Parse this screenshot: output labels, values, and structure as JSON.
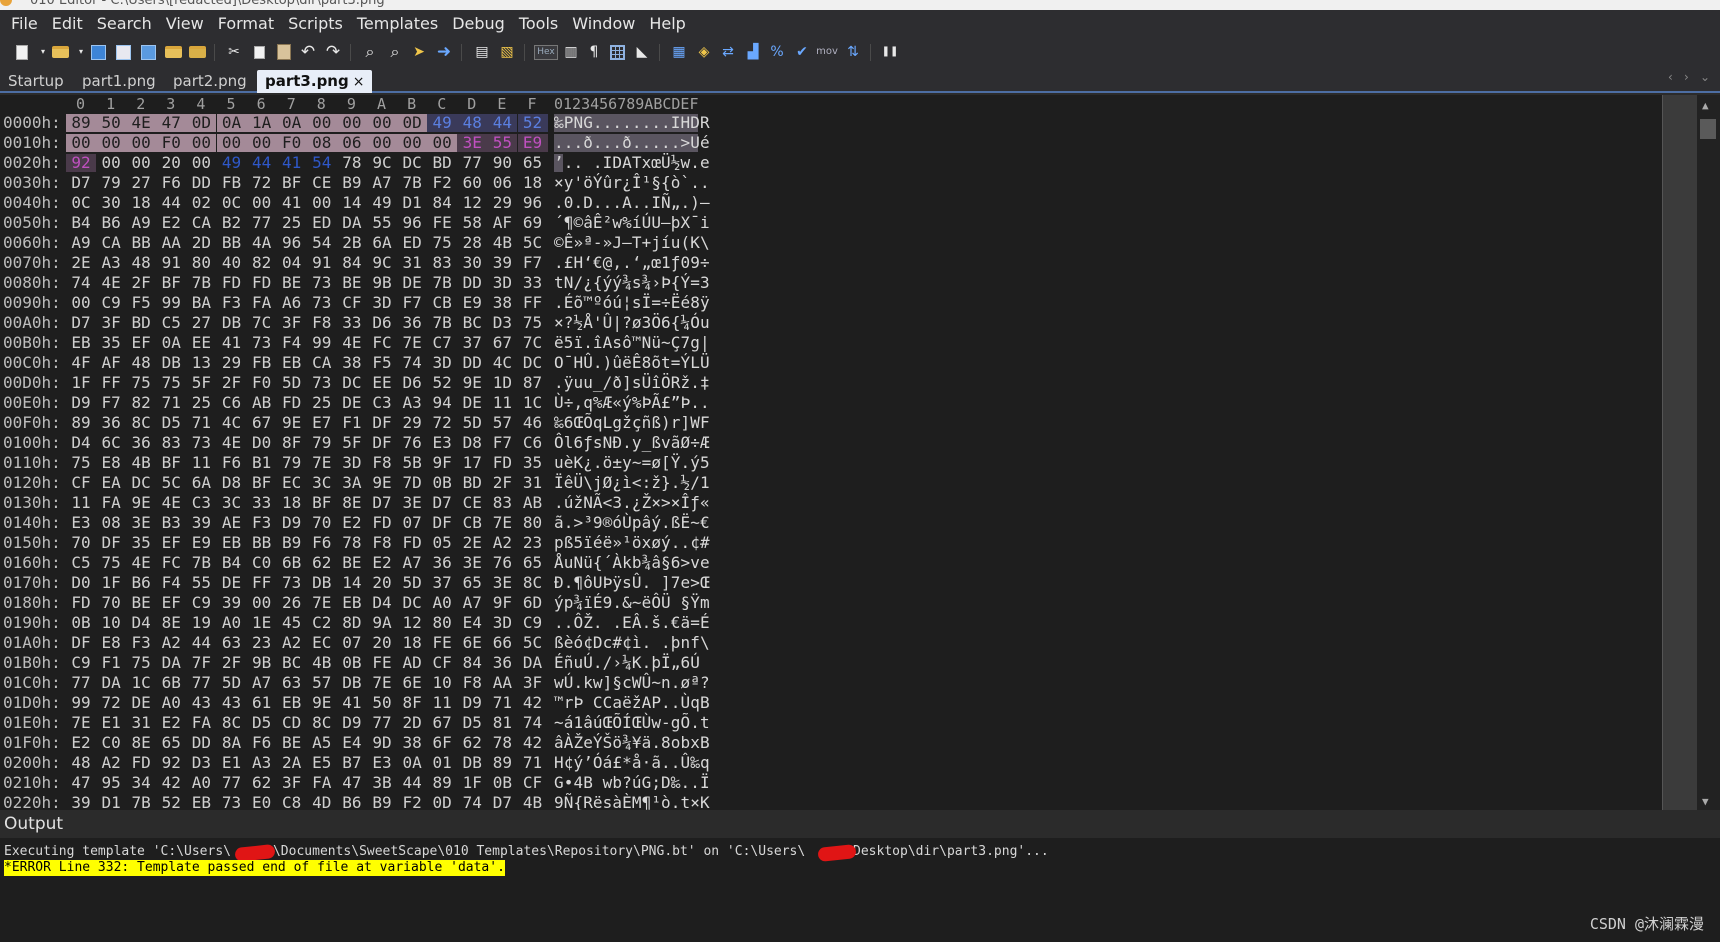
{
  "window": {
    "title": "010 Editor - C:\\Users\\[redacted]\\Desktop\\dir\\part3.png"
  },
  "menu": [
    "File",
    "Edit",
    "Search",
    "View",
    "Format",
    "Scripts",
    "Templates",
    "Debug",
    "Tools",
    "Window",
    "Help"
  ],
  "toolbar": {
    "hex_label": "Hex",
    "mov_label": "mov",
    "icons": [
      "new-file-icon",
      "open-file-icon",
      "save-icon",
      "save-as-icon",
      "save-all-icon",
      "open-folder-icon",
      "open-project-icon",
      "cut-icon",
      "copy-icon",
      "paste-icon",
      "undo-icon",
      "redo-icon",
      "find-icon",
      "find-in-files-icon",
      "goto-icon",
      "forward-icon",
      "bookmark-icon",
      "template-icon",
      "hex-icon",
      "columns-icon",
      "pilcrow-icon",
      "grid-icon",
      "highlight-icon",
      "calculator-icon",
      "inspector-icon",
      "compare-icon",
      "histogram-icon",
      "percent-icon",
      "checksum-icon",
      "mov-icon",
      "convert-icon",
      "pause-icon"
    ]
  },
  "tabs": [
    {
      "label": "Startup",
      "active": false
    },
    {
      "label": "part1.png",
      "active": false
    },
    {
      "label": "part2.png",
      "active": false
    },
    {
      "label": "part3.png",
      "active": true,
      "close": "×"
    }
  ],
  "hex": {
    "column_headers": [
      "0",
      "1",
      "2",
      "3",
      "4",
      "5",
      "6",
      "7",
      "8",
      "9",
      "A",
      "B",
      "C",
      "D",
      "E",
      "F"
    ],
    "ascii_header": "0123456789ABCDEF",
    "rows": [
      {
        "addr": "0000h:",
        "bytes": [
          "89",
          "50",
          "4E",
          "47",
          "0D",
          "0A",
          "1A",
          "0A",
          "00",
          "00",
          "00",
          "0D",
          "49",
          "48",
          "44",
          "52"
        ],
        "ascii": "‰PNG........IHDR"
      },
      {
        "addr": "0010h:",
        "bytes": [
          "00",
          "00",
          "00",
          "F0",
          "00",
          "00",
          "00",
          "F0",
          "08",
          "06",
          "00",
          "00",
          "00",
          "3E",
          "55",
          "E9"
        ],
        "ascii": "...ð...ð.....>Ué"
      },
      {
        "addr": "0020h:",
        "bytes": [
          "92",
          "00",
          "00",
          "20",
          "00",
          "49",
          "44",
          "41",
          "54",
          "78",
          "9C",
          "DC",
          "BD",
          "77",
          "90",
          "65"
        ],
        "ascii": "’.. .IDATxœÜ½w.e"
      },
      {
        "addr": "0030h:",
        "bytes": [
          "D7",
          "79",
          "27",
          "F6",
          "DD",
          "FB",
          "72",
          "BF",
          "CE",
          "B9",
          "A7",
          "7B",
          "F2",
          "60",
          "06",
          "18"
        ],
        "ascii": "×y'öÝûr¿Î¹§{ò`.."
      },
      {
        "addr": "0040h:",
        "bytes": [
          "0C",
          "30",
          "18",
          "44",
          "02",
          "0C",
          "00",
          "41",
          "00",
          "14",
          "49",
          "D1",
          "84",
          "12",
          "29",
          "96"
        ],
        "ascii": ".0.D...A..IÑ„.)–"
      },
      {
        "addr": "0050h:",
        "bytes": [
          "B4",
          "B6",
          "A9",
          "E2",
          "CA",
          "B2",
          "77",
          "25",
          "ED",
          "DA",
          "55",
          "96",
          "FE",
          "58",
          "AF",
          "69"
        ],
        "ascii": "´¶©âÊ²w%íÚU–þX¯i"
      },
      {
        "addr": "0060h:",
        "bytes": [
          "A9",
          "CA",
          "BB",
          "AA",
          "2D",
          "BB",
          "4A",
          "96",
          "54",
          "2B",
          "6A",
          "ED",
          "75",
          "28",
          "4B",
          "5C"
        ],
        "ascii": "©Ê»ª-»J–T+jíu(K\\"
      },
      {
        "addr": "0070h:",
        "bytes": [
          "2E",
          "A3",
          "48",
          "91",
          "80",
          "40",
          "82",
          "04",
          "91",
          "84",
          "9C",
          "31",
          "83",
          "30",
          "39",
          "F7"
        ],
        "ascii": ".£H‘€@‚.‘„œ1ƒ09÷"
      },
      {
        "addr": "0080h:",
        "bytes": [
          "74",
          "4E",
          "2F",
          "BF",
          "7B",
          "FD",
          "FD",
          "BE",
          "73",
          "BE",
          "9B",
          "DE",
          "7B",
          "DD",
          "3D",
          "33"
        ],
        "ascii": "tN/¿{ýý¾s¾›Þ{Ý=3"
      },
      {
        "addr": "0090h:",
        "bytes": [
          "00",
          "C9",
          "F5",
          "99",
          "BA",
          "F3",
          "FA",
          "A6",
          "73",
          "CF",
          "3D",
          "F7",
          "CB",
          "E9",
          "38",
          "FF"
        ],
        "ascii": ".Éõ™ºóú¦sÏ=÷Ëé8ÿ"
      },
      {
        "addr": "00A0h:",
        "bytes": [
          "D7",
          "3F",
          "BD",
          "C5",
          "27",
          "DB",
          "7C",
          "3F",
          "F8",
          "33",
          "D6",
          "36",
          "7B",
          "BC",
          "D3",
          "75"
        ],
        "ascii": "×?½Å'Û|?ø3Ö6{¼Óu"
      },
      {
        "addr": "00B0h:",
        "bytes": [
          "EB",
          "35",
          "EF",
          "0A",
          "EE",
          "41",
          "73",
          "F4",
          "99",
          "4E",
          "FC",
          "7E",
          "C7",
          "37",
          "67",
          "7C"
        ],
        "ascii": "ë5ï.îAsô™Nü~Ç7g|"
      },
      {
        "addr": "00C0h:",
        "bytes": [
          "4F",
          "AF",
          "48",
          "DB",
          "13",
          "29",
          "FB",
          "EB",
          "CA",
          "38",
          "F5",
          "74",
          "3D",
          "DD",
          "4C",
          "DC"
        ],
        "ascii": "O¯HÛ.)ûëÊ8õt=ÝLÜ"
      },
      {
        "addr": "00D0h:",
        "bytes": [
          "1F",
          "FF",
          "75",
          "75",
          "5F",
          "2F",
          "F0",
          "5D",
          "73",
          "DC",
          "EE",
          "D6",
          "52",
          "9E",
          "1D",
          "87"
        ],
        "ascii": ".ÿuu_/ð]sÜîÖRž.‡"
      },
      {
        "addr": "00E0h:",
        "bytes": [
          "D9",
          "F7",
          "82",
          "71",
          "25",
          "C6",
          "AB",
          "FD",
          "25",
          "DE",
          "C3",
          "A3",
          "94",
          "DE",
          "11",
          "1C"
        ],
        "ascii": "Ù÷‚q%Æ«ý%ÞÃ£”Þ.."
      },
      {
        "addr": "00F0h:",
        "bytes": [
          "89",
          "36",
          "8C",
          "D5",
          "71",
          "4C",
          "67",
          "9E",
          "E7",
          "F1",
          "DF",
          "29",
          "72",
          "5D",
          "57",
          "46"
        ],
        "ascii": "‰6ŒÕqLgžçñß)r]WF"
      },
      {
        "addr": "0100h:",
        "bytes": [
          "D4",
          "6C",
          "36",
          "83",
          "73",
          "4E",
          "D0",
          "8F",
          "79",
          "5F",
          "DF",
          "76",
          "E3",
          "D8",
          "F7",
          "C6"
        ],
        "ascii": "Ôl6ƒsNÐ.y_ßvãØ÷Æ"
      },
      {
        "addr": "0110h:",
        "bytes": [
          "75",
          "E8",
          "4B",
          "BF",
          "11",
          "F6",
          "B1",
          "79",
          "7E",
          "3D",
          "F8",
          "5B",
          "9F",
          "17",
          "FD",
          "35"
        ],
        "ascii": "uèK¿.ö±y~=ø[Ÿ.ý5"
      },
      {
        "addr": "0120h:",
        "bytes": [
          "CF",
          "EA",
          "DC",
          "5C",
          "6A",
          "D8",
          "BF",
          "EC",
          "3C",
          "3A",
          "9E",
          "7D",
          "0B",
          "BD",
          "2F",
          "31"
        ],
        "ascii": "ÏêÜ\\jØ¿ì<:ž}.½/1"
      },
      {
        "addr": "0130h:",
        "bytes": [
          "11",
          "FA",
          "9E",
          "4E",
          "C3",
          "3C",
          "33",
          "18",
          "BF",
          "8E",
          "D7",
          "3E",
          "D7",
          "CE",
          "83",
          "AB"
        ],
        "ascii": ".úžNÃ<3.¿Ž×>×Îƒ«"
      },
      {
        "addr": "0140h:",
        "bytes": [
          "E3",
          "08",
          "3E",
          "B3",
          "39",
          "AE",
          "F3",
          "D9",
          "70",
          "E2",
          "FD",
          "07",
          "DF",
          "CB",
          "7E",
          "80"
        ],
        "ascii": "ã.>³9®óÙpâý.ßË~€"
      },
      {
        "addr": "0150h:",
        "bytes": [
          "70",
          "DF",
          "35",
          "EF",
          "E9",
          "EB",
          "BB",
          "B9",
          "F6",
          "78",
          "F8",
          "FD",
          "05",
          "2E",
          "A2",
          "23"
        ],
        "ascii": "pß5ïéë»¹öxøý..¢#"
      },
      {
        "addr": "0160h:",
        "bytes": [
          "C5",
          "75",
          "4E",
          "FC",
          "7B",
          "B4",
          "C0",
          "6B",
          "62",
          "BE",
          "E2",
          "A7",
          "36",
          "3E",
          "76",
          "65"
        ],
        "ascii": "ÅuNü{´Àkb¾â§6>ve"
      },
      {
        "addr": "0170h:",
        "bytes": [
          "D0",
          "1F",
          "B6",
          "F4",
          "55",
          "DE",
          "FF",
          "73",
          "DB",
          "14",
          "20",
          "5D",
          "37",
          "65",
          "3E",
          "8C"
        ],
        "ascii": "Ð.¶ôUÞÿsÛ. ]7e>Œ"
      },
      {
        "addr": "0180h:",
        "bytes": [
          "FD",
          "70",
          "BE",
          "EF",
          "C9",
          "39",
          "00",
          "26",
          "7E",
          "EB",
          "D4",
          "DC",
          "A0",
          "A7",
          "9F",
          "6D"
        ],
        "ascii": "ýp¾ïÉ9.&~ëÔÜ §Ÿm"
      },
      {
        "addr": "0190h:",
        "bytes": [
          "0B",
          "10",
          "D4",
          "8E",
          "19",
          "A0",
          "1E",
          "45",
          "C2",
          "8D",
          "9A",
          "12",
          "80",
          "E4",
          "3D",
          "C9"
        ],
        "ascii": "..ÔŽ. .EÂ.š.€ä=É"
      },
      {
        "addr": "01A0h:",
        "bytes": [
          "DF",
          "E8",
          "F3",
          "A2",
          "44",
          "63",
          "23",
          "A2",
          "EC",
          "07",
          "20",
          "18",
          "FE",
          "6E",
          "66",
          "5C"
        ],
        "ascii": "ßèó¢Dc#¢ì. .þnf\\"
      },
      {
        "addr": "01B0h:",
        "bytes": [
          "C9",
          "F1",
          "75",
          "DA",
          "7F",
          "2F",
          "9B",
          "BC",
          "4B",
          "0B",
          "FE",
          "AD",
          "CF",
          "84",
          "36",
          "DA"
        ],
        "ascii": "ÉñuÚ./›¼K.þ­Ï„6Ú"
      },
      {
        "addr": "01C0h:",
        "bytes": [
          "77",
          "DA",
          "1C",
          "6B",
          "77",
          "5D",
          "A7",
          "63",
          "57",
          "DB",
          "7E",
          "6E",
          "10",
          "F8",
          "AA",
          "3F"
        ],
        "ascii": "wÚ.kw]§cWÛ~n.øª?"
      },
      {
        "addr": "01D0h:",
        "bytes": [
          "99",
          "72",
          "DE",
          "A0",
          "43",
          "43",
          "61",
          "EB",
          "9E",
          "41",
          "50",
          "8F",
          "11",
          "D9",
          "71",
          "42"
        ],
        "ascii": "™rÞ CCaëžAP..ÙqB"
      },
      {
        "addr": "01E0h:",
        "bytes": [
          "7E",
          "E1",
          "31",
          "E2",
          "FA",
          "8C",
          "D5",
          "CD",
          "8C",
          "D9",
          "77",
          "2D",
          "67",
          "D5",
          "81",
          "74"
        ],
        "ascii": "~á1âúŒÕÍŒÙw-gÕ.t"
      },
      {
        "addr": "01F0h:",
        "bytes": [
          "E2",
          "C0",
          "8E",
          "65",
          "DD",
          "8A",
          "F6",
          "BE",
          "A5",
          "E4",
          "9D",
          "38",
          "6F",
          "62",
          "78",
          "42"
        ],
        "ascii": "âÀŽeÝŠö¾¥ä.8obxB"
      },
      {
        "addr": "0200h:",
        "bytes": [
          "48",
          "A2",
          "FD",
          "92",
          "D3",
          "E1",
          "A3",
          "2A",
          "E5",
          "B7",
          "E3",
          "0A",
          "01",
          "DB",
          "89",
          "71"
        ],
        "ascii": "H¢ý’Óá£*å·ã..Û‰q"
      },
      {
        "addr": "0210h:",
        "bytes": [
          "47",
          "95",
          "34",
          "42",
          "A0",
          "77",
          "62",
          "3F",
          "FA",
          "47",
          "3B",
          "44",
          "89",
          "1F",
          "0B",
          "CF"
        ],
        "ascii": "G•4B wb?úG;D‰..Ï"
      },
      {
        "addr": "0220h:",
        "bytes": [
          "39",
          "D1",
          "7B",
          "52",
          "EB",
          "73",
          "E0",
          "C8",
          "4D",
          "B6",
          "B9",
          "F2",
          "0D",
          "74",
          "D7",
          "4B"
        ],
        "ascii": "9Ñ{RësàÈM¶¹ò.t×K"
      }
    ]
  },
  "output": {
    "title": "Output",
    "line1_a": "Executing template 'C:\\Users\\",
    "line1_b": "\\Documents\\SweetScape\\010 Templates\\Repository\\PNG.bt' on 'C:\\Users\\",
    "line1_c": "\\Desktop\\dir\\part3.png'...",
    "error": "*ERROR Line 332: Template passed end of file at variable 'data'."
  },
  "watermark": "CSDN @沐澜霖漫",
  "colors": {
    "selection": "#a48a98",
    "chunk_type": "#2f58c8",
    "crc": "#9b3d9b",
    "error_bg": "#ffff00",
    "background": "#1e1e1e"
  }
}
